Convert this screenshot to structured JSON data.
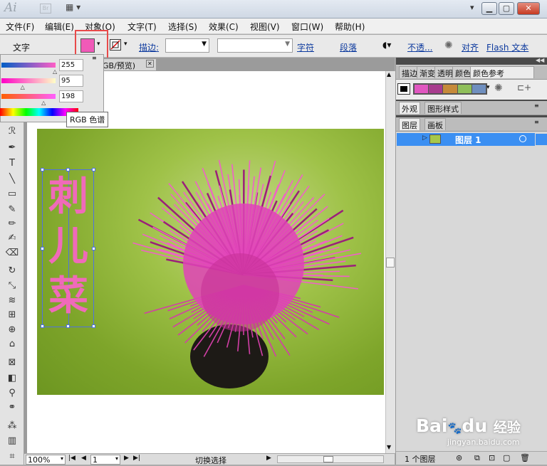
{
  "app": {
    "logo": "Ai",
    "bridge_label": "Br",
    "arrange_icon": "arrange-documents-icon"
  },
  "window_buttons": {
    "minimize": "▁",
    "maximize": "▢",
    "close": "✕"
  },
  "menu": [
    "文件(F)",
    "编辑(E)",
    "对象(O)",
    "文字(T)",
    "选择(S)",
    "效果(C)",
    "视图(V)",
    "窗口(W)",
    "帮助(H)"
  ],
  "control_bar": {
    "context": "文字",
    "fill_color": "#f05ab8",
    "stroke_label": "描边:",
    "character_link": "字符",
    "paragraph_link": "段落",
    "opacity_link": "不透...",
    "align_link": "对齐",
    "flash_text_link": "Flash 文本"
  },
  "color_panel": {
    "r": "255",
    "g": "95",
    "b": "198",
    "r_level": 1.0,
    "g_level": 0.37,
    "b_level": 0.78,
    "tooltip": "RGB 色谱"
  },
  "document": {
    "tab_title": "GB/预览)",
    "tab_close": "✕",
    "artwork_text_chars": [
      "刺",
      "儿",
      "菜"
    ]
  },
  "status_bar": {
    "zoom": "100%",
    "page": "1",
    "mode": "切换选择"
  },
  "panels": {
    "top_tabs": [
      "描边",
      "渐变",
      "透明",
      "颜色",
      "颜色参考"
    ],
    "swatches": [
      "#000000",
      "#e056c0",
      "#a83c8e",
      "#c68a3a",
      "#8fbf5a",
      "#6f8fbf"
    ],
    "mid_tabs": [
      "外观",
      "图形样式"
    ],
    "layer_tabs": [
      "图层",
      "画板"
    ],
    "layer_name": "图层 1",
    "layer_count": "1 个图层"
  },
  "watermark": {
    "brand": "Bai",
    "brand2": "du",
    "brand_cn": "经验",
    "url": "jingyan.baidu.com"
  }
}
